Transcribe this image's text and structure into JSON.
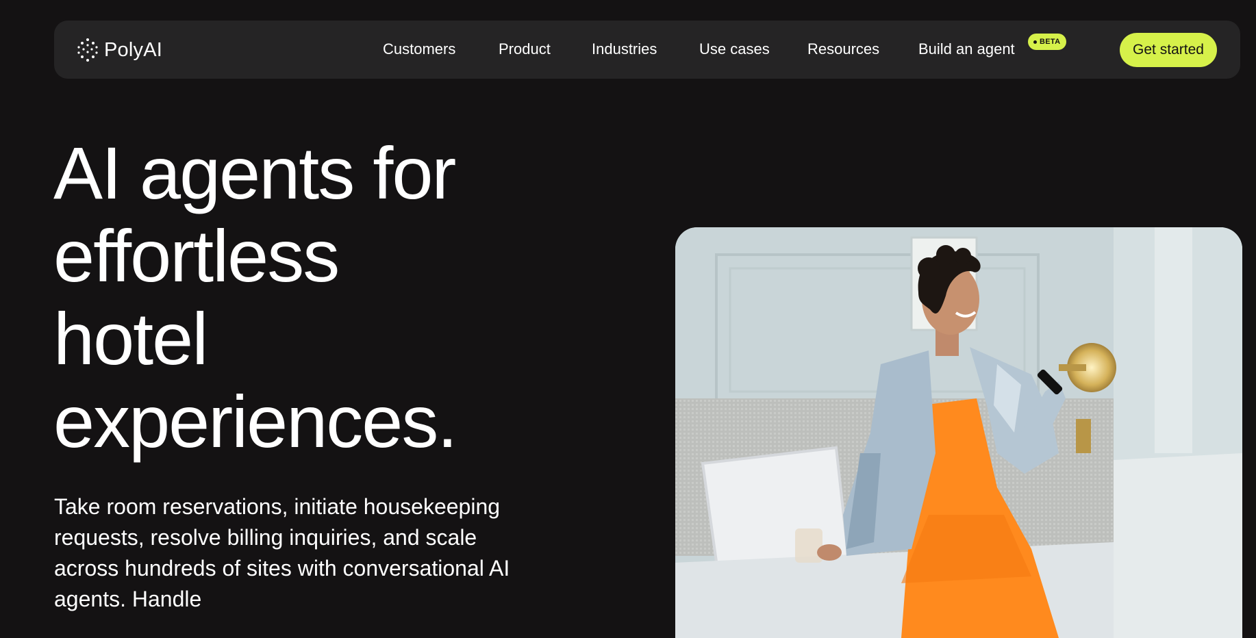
{
  "header": {
    "logo": {
      "text": "PolyAI",
      "icon": "dot-grid-logo-icon"
    },
    "nav": {
      "customers": "Customers",
      "product": "Product",
      "industries": "Industries",
      "use_cases": "Use cases",
      "resources": "Resources",
      "build_agent": "Build an agent"
    },
    "beta_badge": "BETA",
    "cta_label": "Get started"
  },
  "hero": {
    "title_lines": [
      "AI agents for",
      "effortless",
      "hotel",
      "experiences."
    ],
    "description": "Take room reservations, initiate housekeeping requests, resolve billing inquiries, and scale across hundreds of sites with conversational AI agents. Handle"
  },
  "colors": {
    "background": "#141213",
    "nav_background": "#252425",
    "accent": "#d6f14a",
    "text": "#ffffff"
  }
}
